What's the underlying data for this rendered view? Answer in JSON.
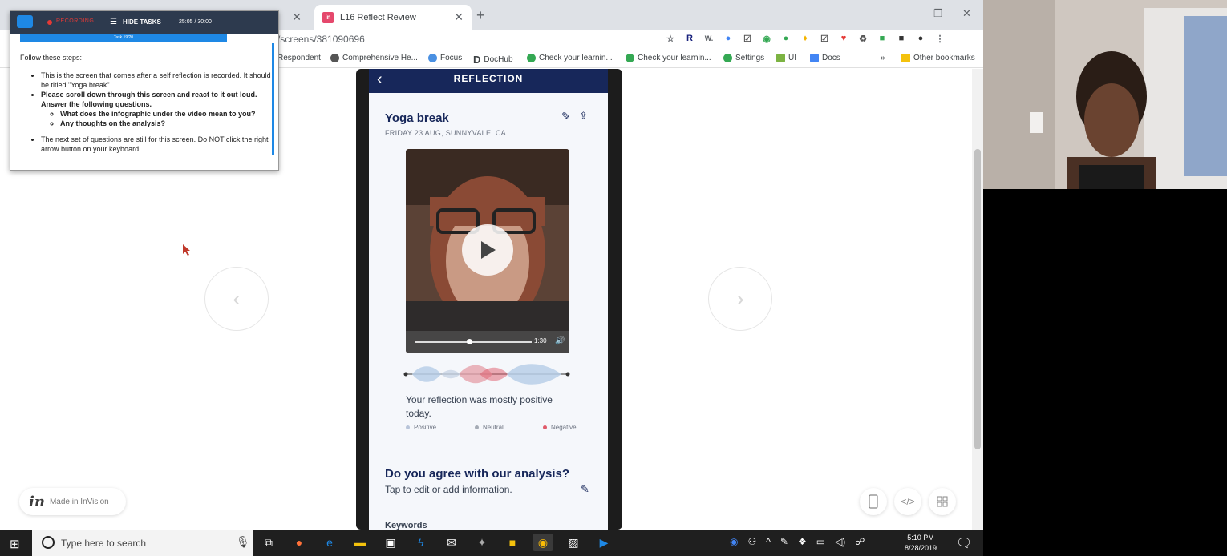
{
  "browser": {
    "tabs": [
      {
        "label": "",
        "active": false
      },
      {
        "label": "L16 Reflect Review",
        "active": true,
        "favicon": "in"
      }
    ],
    "url_partial": "/screens/381090696",
    "window_controls": [
      "–",
      "❐",
      "✕"
    ],
    "extensions": [
      "☆",
      "R",
      "W.",
      "●",
      "☑",
      "◉",
      "●",
      "♦",
      "☑",
      "♥",
      "♻",
      "■",
      "■",
      "●",
      "⋮"
    ],
    "bookmarks": [
      {
        "label": "Respondent",
        "color": "#ffffff"
      },
      {
        "label": "Comprehensive He...",
        "color": "#555555"
      },
      {
        "label": "Focus",
        "color": "#4a90e2"
      },
      {
        "label": "DocHub",
        "color": "#111111"
      },
      {
        "label": "Check your learnin...",
        "color": "#34a853"
      },
      {
        "label": "Check your learnin...",
        "color": "#34a853"
      },
      {
        "label": "Settings",
        "color": "#34a853"
      },
      {
        "label": "UI",
        "color": "#7cb342"
      },
      {
        "label": "Docs",
        "color": "#4285f4"
      },
      {
        "label": "»",
        "color": "#ffffff"
      },
      {
        "label": "Other bookmarks",
        "color": "#f4c20d"
      }
    ]
  },
  "task_panel": {
    "recording_label": "RECORDING",
    "hide_tasks_label": "HIDE TASKS",
    "timer": "25:05 / 30:00",
    "progress_label": "Task 19/20",
    "intro": "Follow these steps:",
    "step1": "This is the screen that comes after a self reflection is recorded. It should be titled \"Yoga break\"",
    "step2": "Please scroll down through this screen and react to it out loud. Answer the following questions.",
    "sub1": "What does the infographic under the video mean to you?",
    "sub2": "Any thoughts on the analysis?",
    "step3": "The next set of questions are still for this screen. Do NOT click the right arrow button on your keyboard."
  },
  "app": {
    "header_title": "REFLECTION",
    "back_glyph": "‹",
    "reflection_title": "Yoga break",
    "reflection_meta": "FRIDAY 23 AUG, SUNNYVALE, CA",
    "video_time": "1:30",
    "video_progress": 0.46,
    "summary": "Your reflection was mostly positive today.",
    "legend": [
      {
        "label": "Positive",
        "color": "#b8c4d9"
      },
      {
        "label": "Neutral",
        "color": "#a5abb5"
      },
      {
        "label": "Negative",
        "color": "#e05a6a"
      }
    ],
    "agree_title": "Do you agree with our analysis?",
    "agree_sub": "Tap to edit or add information.",
    "keywords_label": "Keywords"
  },
  "prototype": {
    "made_in_logo": "in",
    "made_in_label": "Made in InVision",
    "prev_arrow": "‹",
    "next_arrow": "›"
  },
  "taskbar": {
    "search_placeholder": "Type here to search",
    "time": "5:10 PM",
    "date": "8/28/2019"
  },
  "colors": {
    "app_header": "#17275a",
    "task_header": "#2d3a4e",
    "accent_blue": "#1e88e5"
  }
}
